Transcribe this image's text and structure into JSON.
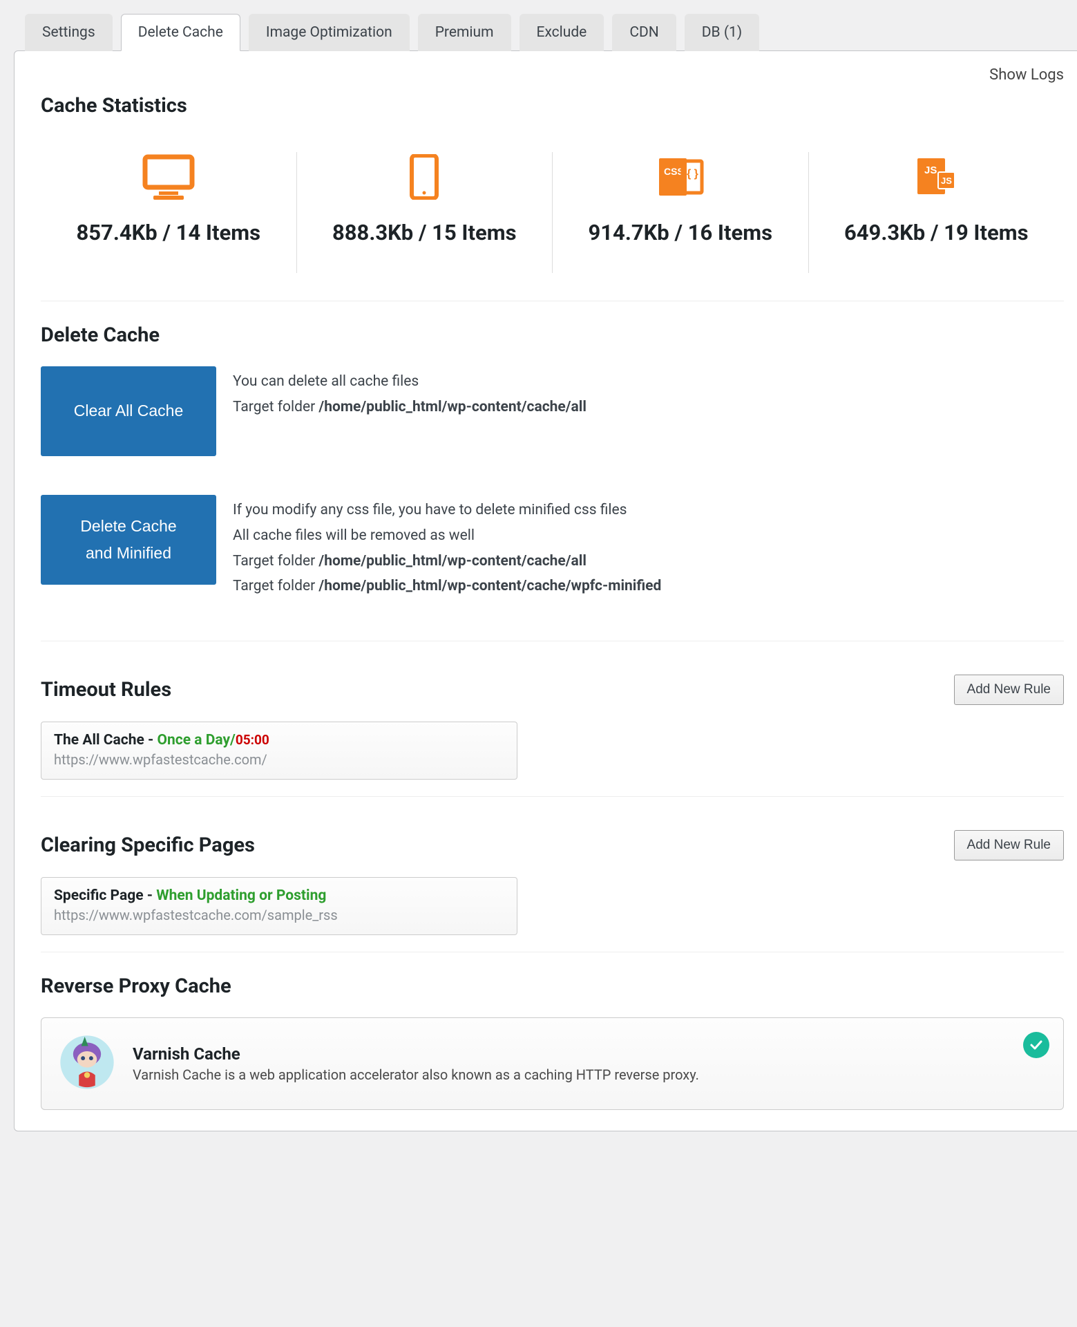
{
  "tabs": {
    "settings": "Settings",
    "delete_cache": "Delete Cache",
    "image_opt": "Image Optimization",
    "premium": "Premium",
    "exclude": "Exclude",
    "cdn": "CDN",
    "db": "DB (1)"
  },
  "show_logs": "Show Logs",
  "sections": {
    "cache_stats": "Cache Statistics",
    "delete_cache": "Delete Cache",
    "timeout_rules": "Timeout Rules",
    "clearing_pages": "Clearing Specific Pages",
    "reverse_proxy": "Reverse Proxy Cache"
  },
  "stats": {
    "desktop": "857.4Kb / 14 Items",
    "mobile": "888.3Kb / 15 Items",
    "css": "914.7Kb / 16 Items",
    "js": "649.3Kb / 19 Items"
  },
  "buttons": {
    "clear_all": "Clear All Cache",
    "delete_minified_l1": "Delete Cache",
    "delete_minified_l2": "and Minified",
    "add_new_rule": "Add New Rule"
  },
  "clear_all": {
    "line1": "You can delete all cache files",
    "target_label": "Target folder ",
    "target_path": "/home/public_html/wp-content/cache/all"
  },
  "delete_minified": {
    "line1": "If you modify any css file, you have to delete minified css files",
    "line2": "All cache files will be removed as well",
    "target_label": "Target folder ",
    "target_path1": "/home/public_html/wp-content/cache/all",
    "target_path2": "/home/public_html/wp-content/cache/wpfc-minified"
  },
  "timeout_rule": {
    "name": "The All Cache - ",
    "freq": "Once a Day",
    "sep": "/",
    "time": "05:00",
    "url": "https://www.wpfastestcache.com/"
  },
  "clearing_rule": {
    "name": "Specific Page - ",
    "freq": "When Updating or Posting",
    "url": "https://www.wpfastestcache.com/sample_rss"
  },
  "proxy": {
    "name": "Varnish Cache",
    "desc": "Varnish Cache is a web application accelerator also known as a caching HTTP reverse proxy."
  }
}
